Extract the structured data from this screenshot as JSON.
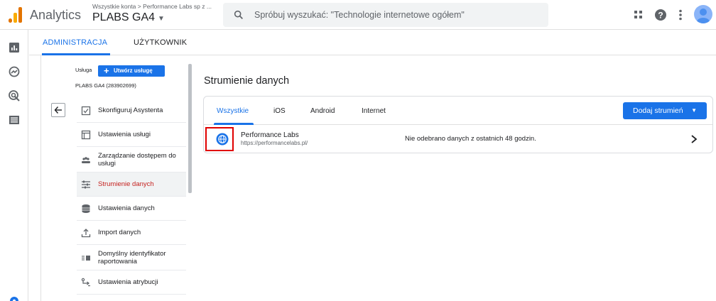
{
  "app": {
    "name": "Analytics",
    "account_breadcrumb": "Wszystkie konta > Performance Labs sp z ...",
    "property_name": "PLABS GA4"
  },
  "search": {
    "placeholder": "Spróbuj wyszukać: \"Technologie internetowe ogółem\""
  },
  "toolbar_icons": [
    "apps-grid-icon",
    "help-icon",
    "more-vert-icon",
    "account-avatar"
  ],
  "rail_icons": [
    "reports-icon",
    "explore-icon",
    "advertising-icon",
    "configure-icon",
    "admin-gear-icon"
  ],
  "admin_tabs": [
    {
      "label": "ADMINISTRACJA",
      "active": true
    },
    {
      "label": "UŻYTKOWNIK",
      "active": false
    }
  ],
  "property_panel": {
    "label": "Usługa",
    "create_button": "Utwórz usługę",
    "property_id": "PLABS GA4 (283902699)"
  },
  "nav_items": [
    {
      "label": "Skonfiguruj Asystenta",
      "icon": "checkbox-icon",
      "active": false
    },
    {
      "label": "Ustawienia usługi",
      "icon": "property-settings-icon",
      "active": false
    },
    {
      "label": "Zarządzanie dostępem do usługi",
      "icon": "people-icon",
      "active": false
    },
    {
      "label": "Strumienie danych",
      "icon": "data-streams-icon",
      "active": true
    },
    {
      "label": "Ustawienia danych",
      "icon": "database-icon",
      "active": false
    },
    {
      "label": "Import danych",
      "icon": "upload-icon",
      "active": false
    },
    {
      "label": "Domyślny identyfikator raportowania",
      "icon": "reporting-id-icon",
      "active": false
    },
    {
      "label": "Ustawienia atrybucji",
      "icon": "attribution-icon",
      "active": false
    }
  ],
  "main": {
    "title": "Strumienie danych",
    "stream_tabs": [
      {
        "label": "Wszystkie",
        "active": true
      },
      {
        "label": "iOS",
        "active": false
      },
      {
        "label": "Android",
        "active": false
      },
      {
        "label": "Internet",
        "active": false
      }
    ],
    "add_stream_button": "Dodaj strumień",
    "streams": [
      {
        "name": "Performance Labs",
        "url": "https://performancelabs.pl/",
        "status": "Nie odebrano danych z ostatnich 48 godzin.",
        "icon": "web-globe-icon"
      }
    ]
  },
  "colors": {
    "accent": "#1a73e8",
    "active_nav_text": "#c5221f",
    "highlight_box": "#e00000"
  }
}
